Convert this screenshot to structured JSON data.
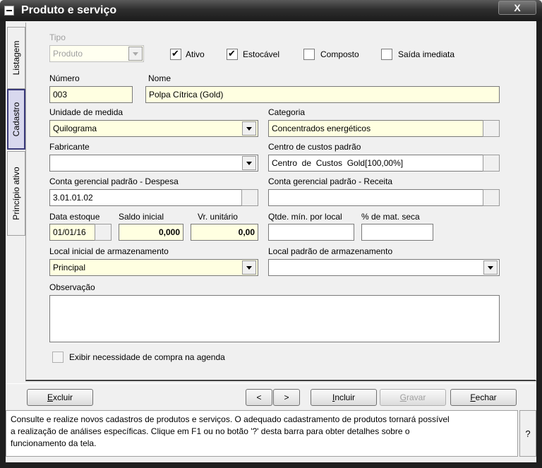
{
  "window": {
    "title": "Produto e serviço",
    "close_label": "X"
  },
  "side_tabs": [
    {
      "label": "Listagem",
      "active": false
    },
    {
      "label": "Cadastro",
      "active": true
    },
    {
      "label": "Princípio ativo",
      "active": false
    }
  ],
  "form": {
    "tipo": {
      "label": "Tipo",
      "value": "Produto"
    },
    "ativo": {
      "label": "Ativo",
      "checked": true
    },
    "estocavel": {
      "label": "Estocável",
      "checked": true
    },
    "composto": {
      "label": "Composto",
      "checked": false
    },
    "saida_imediata": {
      "label": "Saída imediata",
      "checked": false
    },
    "numero": {
      "label": "Número",
      "value": "003"
    },
    "nome": {
      "label": "Nome",
      "value": "Polpa Cítrica (Gold)"
    },
    "unidade": {
      "label": "Unidade de medida",
      "value": "Quilograma"
    },
    "categoria": {
      "label": "Categoria",
      "value": "Concentrados energéticos"
    },
    "fabricante": {
      "label": "Fabricante",
      "value": ""
    },
    "centro_custos": {
      "label": "Centro de custos padrão",
      "value": "Centro  de  Custos  Gold[100,00%]"
    },
    "conta_despesa": {
      "label": "Conta gerencial padrão - Despesa",
      "value": "3.01.01.02"
    },
    "conta_receita": {
      "label": "Conta gerencial padrão - Receita",
      "value": ""
    },
    "data_estoque": {
      "label": "Data estoque",
      "value": "01/01/16"
    },
    "saldo_inicial": {
      "label": "Saldo inicial",
      "value": "0,000"
    },
    "vr_unitario": {
      "label": "Vr. unitário",
      "value": "0,00"
    },
    "qtde_min": {
      "label": "Qtde. mín. por local",
      "value": ""
    },
    "mat_seca": {
      "label": "% de mat. seca",
      "value": ""
    },
    "local_inicial": {
      "label": "Local inicial de armazenamento",
      "value": "Principal"
    },
    "local_padrao": {
      "label": "Local padrão de armazenamento",
      "value": ""
    },
    "observacao": {
      "label": "Observação",
      "value": ""
    },
    "exibir_necessidade": {
      "label": "Exibir necessidade de compra na agenda",
      "checked": false
    }
  },
  "buttons": {
    "excluir": {
      "label": "Excluir",
      "accel": "E",
      "rest": "xcluir"
    },
    "prev": "<",
    "next": ">",
    "incluir": {
      "label": "Incluir",
      "accel": "I",
      "rest": "ncluir"
    },
    "gravar": {
      "label": "Gravar",
      "accel": "G",
      "rest": "ravar"
    },
    "fechar": {
      "label": "Fechar",
      "accel": "F",
      "rest": "echar"
    }
  },
  "hint": {
    "lines": [
      "Consulte e realize novos cadastros de produtos e serviços. O adequado cadastramento de produtos tornará possível",
      "a realização de análises específicas. Clique em F1 ou no botão '?' desta barra para obter detalhes sobre o",
      "funcionamento da tela."
    ],
    "help_label": "?"
  }
}
